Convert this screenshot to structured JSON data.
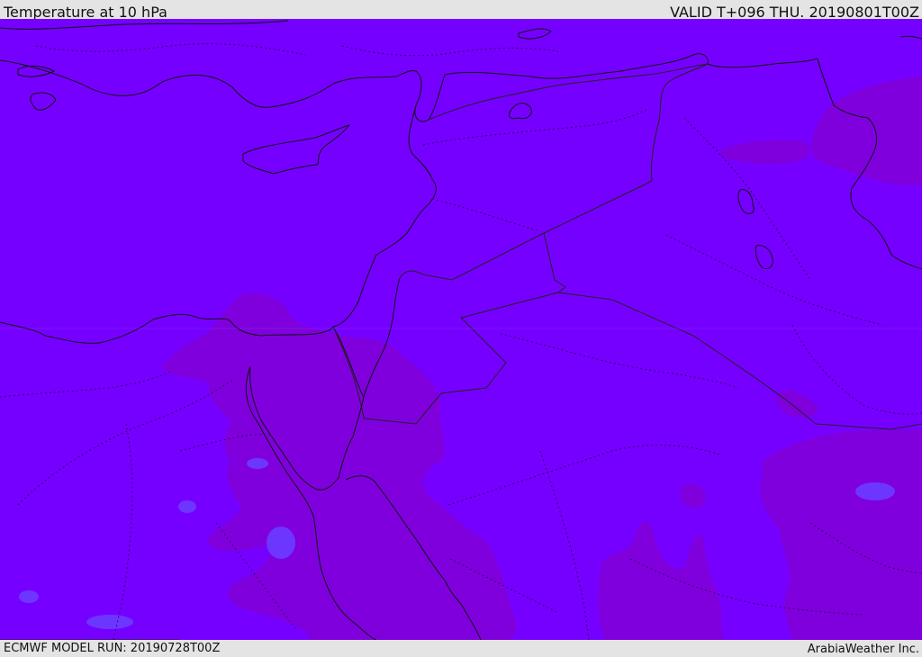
{
  "header": {
    "title": "Temperature at 10 hPa",
    "valid": "VALID T+096 THU. 20190801T00Z"
  },
  "footer": {
    "model_run": "ECMWF MODEL RUN: 20190728T00Z",
    "credit": "ArabiaWeather Inc."
  },
  "map": {
    "colors": {
      "field_base": "#7600ff",
      "field_warm": "#7f00dd",
      "field_cool": "#6d36ff",
      "coastline": "#111111",
      "border": "#222222"
    }
  }
}
